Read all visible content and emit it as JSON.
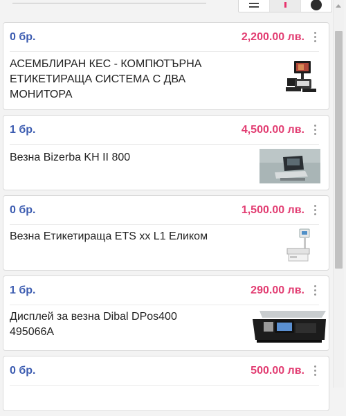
{
  "products": [
    {
      "qty": "0 бр.",
      "price": "2,200.00 лв.",
      "name": "АСЕМБЛИРАН КЕС - КОМПЮТЪРНА ЕТИКЕТИРАЩА СИСТЕМА С ДВА МОНИТОРА",
      "icon": "pos-system-icon"
    },
    {
      "qty": "1 бр.",
      "price": "4,500.00 лв.",
      "name": "Везна Bizerba KH II 800",
      "icon": "scale-icon"
    },
    {
      "qty": "0 бр.",
      "price": "1,500.00 лв.",
      "name": "Везна Етикетираща ETS xx L1 Еликом",
      "icon": "label-scale-icon"
    },
    {
      "qty": "1 бр.",
      "price": "290.00 лв.",
      "name": "Дисплей за везна Dibal DPos400 495066A",
      "icon": "scale-display-icon"
    },
    {
      "qty": "0 бр.",
      "price": "500.00 лв.",
      "name": "",
      "icon": ""
    }
  ],
  "colors": {
    "qty": "#3b5bb0",
    "price": "#e23d72",
    "accent": "#e8336d"
  }
}
